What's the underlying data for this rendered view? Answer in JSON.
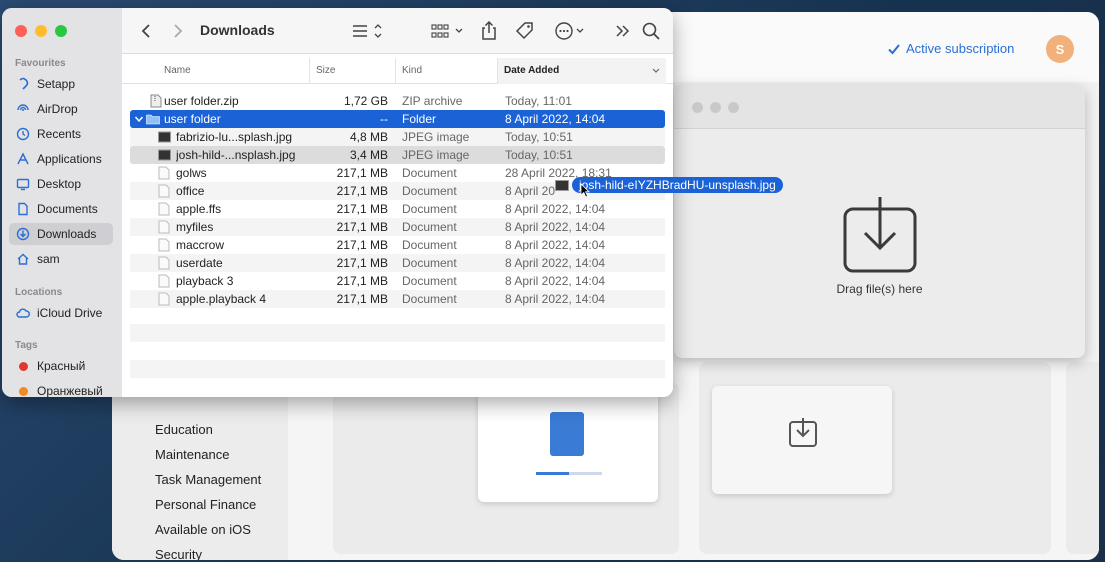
{
  "finder": {
    "title": "Downloads",
    "sidebar": {
      "favourites_label": "Favourites",
      "favourites": [
        {
          "label": "Setapp",
          "icon": "setapp-icon"
        },
        {
          "label": "AirDrop",
          "icon": "airdrop-icon"
        },
        {
          "label": "Recents",
          "icon": "clock-icon"
        },
        {
          "label": "Applications",
          "icon": "applications-icon"
        },
        {
          "label": "Desktop",
          "icon": "desktop-icon"
        },
        {
          "label": "Documents",
          "icon": "document-icon"
        },
        {
          "label": "Downloads",
          "icon": "downloads-icon"
        },
        {
          "label": "sam",
          "icon": "home-icon"
        }
      ],
      "locations_label": "Locations",
      "locations": [
        {
          "label": "iCloud Drive",
          "icon": "cloud-icon"
        }
      ],
      "tags_label": "Tags",
      "tags": [
        {
          "label": "Красный",
          "color": "#e0382e"
        },
        {
          "label": "Оранжевый",
          "color": "#f08a24"
        }
      ]
    },
    "columns": {
      "name": "Name",
      "size": "Size",
      "kind": "Kind",
      "date": "Date Added"
    },
    "files": [
      {
        "name": "user folder.zip",
        "size": "1,72 GB",
        "kind": "ZIP archive",
        "date": "Today, 11:01",
        "icon": "zip-icon"
      },
      {
        "name": "user folder",
        "size": "--",
        "kind": "Folder",
        "date": "8 April 2022, 14:04",
        "icon": "folder-icon"
      },
      {
        "name": "fabrizio-lu...splash.jpg",
        "size": "4,8 MB",
        "kind": "JPEG image",
        "date": "Today, 10:51",
        "icon": "image-icon"
      },
      {
        "name": "josh-hild-...nsplash.jpg",
        "size": "3,4 MB",
        "kind": "JPEG image",
        "date": "Today, 10:51",
        "icon": "image-icon"
      },
      {
        "name": "golws",
        "size": "217,1 MB",
        "kind": "Document",
        "date": "28 April 2022, 18:31",
        "icon": "document-icon"
      },
      {
        "name": "office",
        "size": "217,1 MB",
        "kind": "Document",
        "date": "8 April 20",
        "icon": "document-icon"
      },
      {
        "name": "apple.ffs",
        "size": "217,1 MB",
        "kind": "Document",
        "date": "8 April 2022, 14:04",
        "icon": "document-icon"
      },
      {
        "name": "myfiles",
        "size": "217,1 MB",
        "kind": "Document",
        "date": "8 April 2022, 14:04",
        "icon": "document-icon"
      },
      {
        "name": "maccrow",
        "size": "217,1 MB",
        "kind": "Document",
        "date": "8 April 2022, 14:04",
        "icon": "document-icon"
      },
      {
        "name": "userdate",
        "size": "217,1 MB",
        "kind": "Document",
        "date": "8 April 2022, 14:04",
        "icon": "document-icon"
      },
      {
        "name": "playback 3",
        "size": "217,1 MB",
        "kind": "Document",
        "date": "8 April 2022, 14:04",
        "icon": "document-icon"
      },
      {
        "name": "apple.playback 4",
        "size": "217,1 MB",
        "kind": "Document",
        "date": "8 April 2022, 14:04",
        "icon": "document-icon"
      }
    ],
    "drag_label": "josh-hild-eIYZHBradHU-unsplash.jpg"
  },
  "setapp": {
    "subscription": "Active subscription",
    "avatar_initial": "S",
    "categories": [
      "Education",
      "Maintenance",
      "Task Management",
      "Personal Finance",
      "Available on iOS",
      "Security"
    ]
  },
  "archiver": {
    "drop_text": "Drag file(s) here"
  },
  "colors": {
    "accent": "#1a62d6",
    "link": "#2a6fd6"
  }
}
